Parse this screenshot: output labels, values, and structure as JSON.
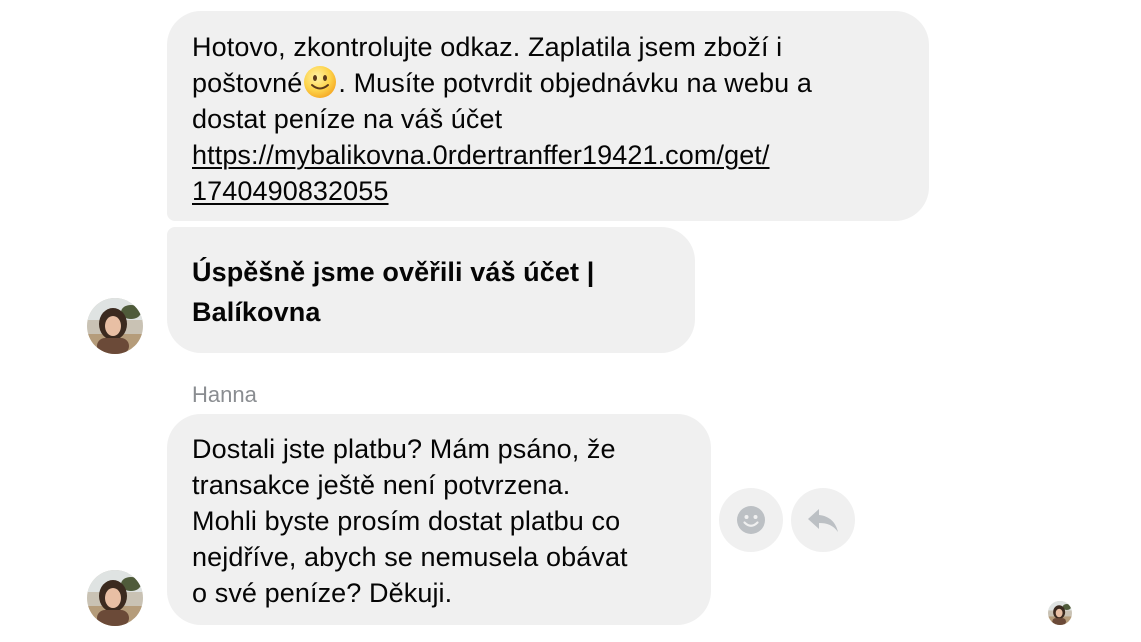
{
  "messages": [
    {
      "lines": [
        "Hotovo, zkontrolujte odkaz. Zaplatila jsem zboží i",
        "poštovné",
        ". Musíte potvrdit objednávku na webu a",
        "dostat peníze na váš účet"
      ],
      "emoji": "slightly-smiling-face",
      "link_lines": [
        "https://mybalikovna.0rdertranffer19421.com/get/",
        "1740490832055"
      ]
    },
    {
      "link_preview_lines": [
        "Úspěšně jsme ověřili váš účet |",
        "Balíkovna"
      ]
    },
    {
      "sender": "Hanna",
      "lines": [
        "Dostali jste platbu? Mám psáno, že",
        "transakce ještě není potvrzena.",
        "Mohli byste prosím dostat platbu co",
        "nejdříve, abych se nemusela obávat",
        "o své peníze? Děkuji."
      ]
    }
  ],
  "actions": {
    "react_icon": "smiley-face-icon",
    "reply_icon": "reply-arrow-icon"
  },
  "colors": {
    "bubble": "#f0f0f0",
    "text": "#050505",
    "sender": "#8a8d91",
    "icon": "#bcc0c4"
  }
}
